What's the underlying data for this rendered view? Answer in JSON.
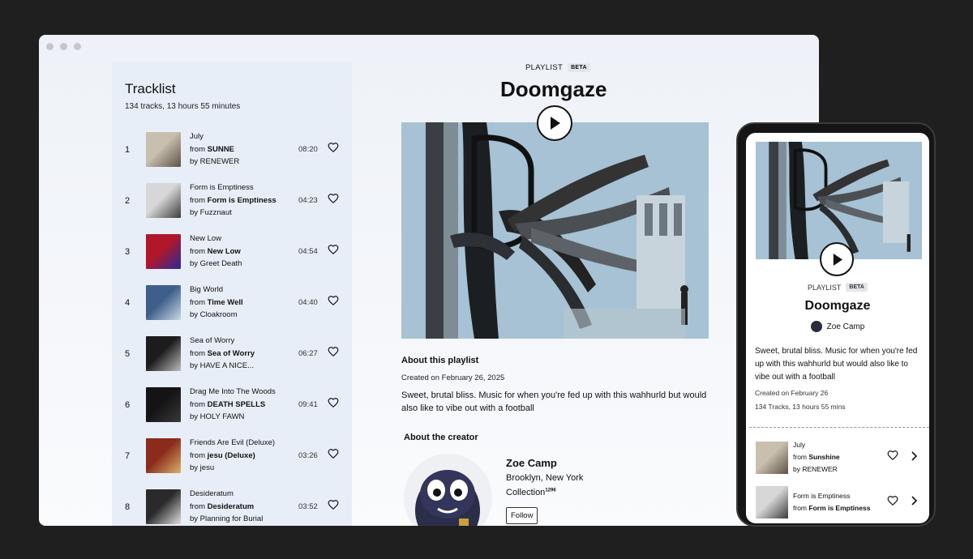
{
  "tracklist": {
    "title": "Tracklist",
    "summary": "134 tracks, 13 hours 55 minutes",
    "tracks": [
      {
        "num": "1",
        "title": "July",
        "from_prefix": "from ",
        "album": "SUNNE",
        "by": "by RENEWER",
        "duration": "08:20"
      },
      {
        "num": "2",
        "title": "Form is Emptiness",
        "from_prefix": "from ",
        "album": "Form is Emptiness",
        "by": "by Fuzznaut",
        "duration": "04:23"
      },
      {
        "num": "3",
        "title": "New Low",
        "from_prefix": "from ",
        "album": "New Low",
        "by": "by Greet Death",
        "duration": "04:54"
      },
      {
        "num": "4",
        "title": "Big World",
        "from_prefix": "from ",
        "album": "Time Well",
        "by": "by Cloakroom",
        "duration": "04:40"
      },
      {
        "num": "5",
        "title": "Sea of Worry",
        "from_prefix": "from ",
        "album": "Sea of Worry",
        "by": "by HAVE A NICE...",
        "duration": "06:27"
      },
      {
        "num": "6",
        "title": "Drag Me Into The Woods",
        "from_prefix": "from ",
        "album": "DEATH SPELLS",
        "by": "by HOLY FAWN",
        "duration": "09:41"
      },
      {
        "num": "7",
        "title": "Friends Are Evil (Deluxe)",
        "from_prefix": "from ",
        "album": "jesu (Deluxe)",
        "by": "by jesu",
        "duration": "03:26"
      },
      {
        "num": "8",
        "title": "Desideratum",
        "from_prefix": "from ",
        "album": "Desideratum",
        "by": "by Planning for Burial",
        "duration": "03:52"
      }
    ]
  },
  "playlist": {
    "eyebrow": "PLAYLIST",
    "badge": "BETA",
    "title": "Doomgaze",
    "about_heading": "About this playlist",
    "created": "Created on February 26, 2025",
    "description": "Sweet, brutal bliss. Music for when you're fed up with this wahhurld but would also like to vibe out with a football"
  },
  "creator": {
    "heading": "About the creator",
    "name": "Zoe Camp",
    "location": "Brooklyn, New York",
    "collection_label": "Collection",
    "collection_count": "1296",
    "follow_label": "Follow"
  },
  "mobile": {
    "eyebrow": "PLAYLIST",
    "badge": "BETA",
    "title": "Doomgaze",
    "author": "Zoe Camp",
    "description": "Sweet, brutal bliss. Music for when you're fed up with this wahhurld but would also like to vibe out with a football",
    "created": "Created on February 26",
    "count": "134 Tracks, 13 hours 55 mins",
    "tracks": [
      {
        "title": "July",
        "from_prefix": "from ",
        "album": "Sunshine",
        "by": "by RENEWER"
      },
      {
        "title": "Form is Emptiness",
        "from_prefix": "from ",
        "album": "Form is Emptiness",
        "by": ""
      }
    ]
  },
  "icons": [
    "play-icon",
    "heart-icon",
    "chevron-right-icon"
  ]
}
